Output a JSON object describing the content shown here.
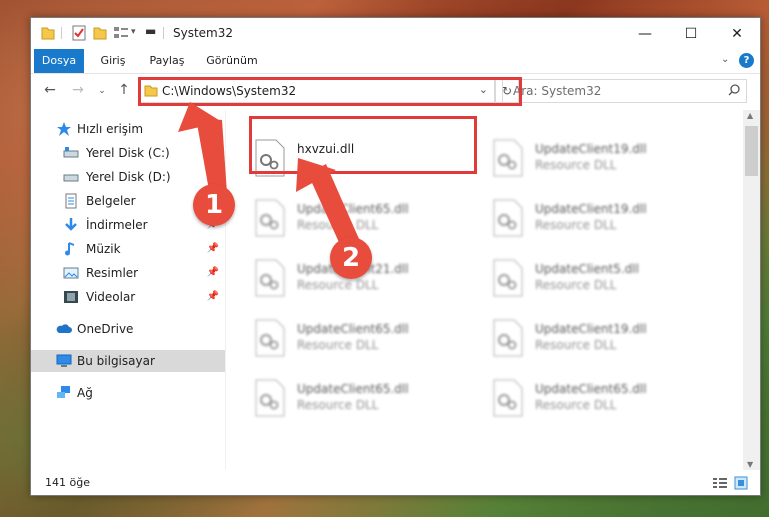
{
  "window": {
    "title": "System32",
    "controls": {
      "minimize": "—",
      "maximize": "☐",
      "close": "✕"
    }
  },
  "ribbon": {
    "tabs": [
      {
        "label": "Dosya",
        "active": true
      },
      {
        "label": "Giriş",
        "active": false
      },
      {
        "label": "Paylaş",
        "active": false
      },
      {
        "label": "Görünüm",
        "active": false
      }
    ],
    "help": "?"
  },
  "nav": {
    "address": "C:\\Windows\\System32",
    "search_placeholder": "Ara: System32"
  },
  "sidebar": {
    "items": [
      {
        "label": "Hızlı erişim",
        "icon": "star-icon",
        "pinned": false
      },
      {
        "label": "Yerel Disk (C:)",
        "icon": "drive-icon",
        "pinned": true
      },
      {
        "label": "Yerel Disk (D:)",
        "icon": "drive-icon",
        "pinned": true
      },
      {
        "label": "Belgeler",
        "icon": "documents-icon",
        "pinned": true
      },
      {
        "label": "İndirmeler",
        "icon": "downloads-icon",
        "pinned": true
      },
      {
        "label": "Müzik",
        "icon": "music-icon",
        "pinned": true
      },
      {
        "label": "Resimler",
        "icon": "pictures-icon",
        "pinned": true
      },
      {
        "label": "Videolar",
        "icon": "videos-icon",
        "pinned": true
      },
      {
        "label": "OneDrive",
        "icon": "onedrive-icon",
        "pinned": false
      },
      {
        "label": "Bu bilgisayar",
        "icon": "computer-icon",
        "pinned": false,
        "selected": true
      },
      {
        "label": "Ağ",
        "icon": "network-icon",
        "pinned": false
      }
    ]
  },
  "files": [
    {
      "name": "hxvzui.dll",
      "type": "",
      "highlight": true
    },
    {
      "name": "UpdateClient19.dll",
      "type": "Resource DLL"
    },
    {
      "name": "UpdateClient65.dll",
      "type": "Resource DLL"
    },
    {
      "name": "UpdateClient19.dll",
      "type": "Resource DLL"
    },
    {
      "name": "UpdateClient21.dll",
      "type": "Resource DLL"
    },
    {
      "name": "UpdateClient5.dll",
      "type": "Resource DLL"
    },
    {
      "name": "UpdateClient65.dll",
      "type": "Resource DLL"
    },
    {
      "name": "UpdateClient19.dll",
      "type": "Resource DLL"
    },
    {
      "name": "UpdateClient65.dll",
      "type": "Resource DLL"
    },
    {
      "name": "UpdateClient65.dll",
      "type": "Resource DLL"
    }
  ],
  "status": {
    "count": "141 öğe"
  },
  "annotations": {
    "badge1": "1",
    "badge2": "2",
    "color": "#e03a3a"
  }
}
